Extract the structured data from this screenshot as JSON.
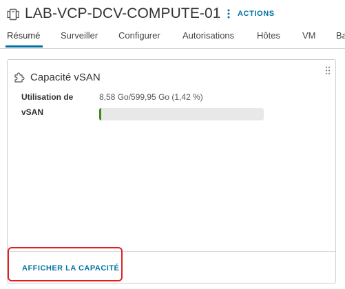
{
  "header": {
    "title": "LAB-VCP-DCV-COMPUTE-01",
    "actions_label": "ACTIONS",
    "icons": {
      "object": "cluster-icon",
      "actions": "vertical-ellipsis-icon"
    }
  },
  "tabs": [
    {
      "label": "Résumé",
      "active": true
    },
    {
      "label": "Surveiller"
    },
    {
      "label": "Configurer"
    },
    {
      "label": "Autorisations"
    },
    {
      "label": "Hôtes"
    },
    {
      "label": "VM"
    },
    {
      "label": "Ba"
    }
  ],
  "card": {
    "title": "Capacité vSAN",
    "icon": "puzzle-icon",
    "drag_icon": "drag-handle-icon",
    "usage_label_line1": "Utilisation de",
    "usage_label_line2": "vSAN",
    "usage_value": "8,58 Go/599,95 Go (1,42 %)",
    "usage_fraction": 0.0142,
    "footer_link": "AFFICHER LA CAPACITÉ"
  },
  "colors": {
    "accent": "#0072a3",
    "progress_fill": "#3d8b1a",
    "progress_track": "#e8e8e8",
    "highlight": "#e02020"
  }
}
